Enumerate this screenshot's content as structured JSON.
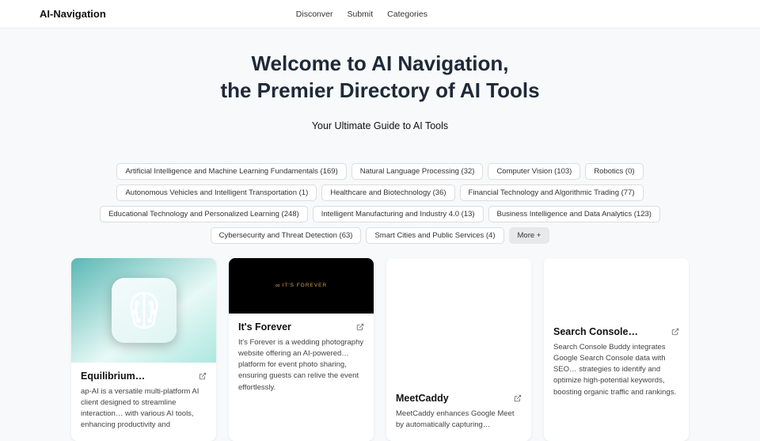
{
  "header": {
    "brand": "AI-Navigation",
    "links": [
      "Disconver",
      "Submit",
      "Categories"
    ]
  },
  "hero": {
    "title_line1": "Welcome to AI Navigation,",
    "title_line2": "the Premier Directory of AI Tools",
    "subtitle": "Your Ultimate Guide to AI Tools"
  },
  "categories": [
    "Artificial Intelligence and Machine Learning Fundamentals (169)",
    "Natural Language Processing (32)",
    "Computer Vision (103)",
    "Robotics (0)",
    "Autonomous Vehicles and Intelligent Transportation (1)",
    "Healthcare and Biotechnology (36)",
    "Financial Technology and Algorithmic Trading (77)",
    "Educational Technology and Personalized Learning (248)",
    "Intelligent Manufacturing and Industry 4.0 (13)",
    "Business Intelligence and Data Analytics (123)",
    "Cybersecurity and Threat Detection (63)",
    "Smart Cities and Public Services (4)"
  ],
  "more_label": "More +",
  "cards": [
    {
      "title": "Equilibrium…",
      "desc": "ap-AI is a versatile multi-platform AI client designed to streamline interaction… with various AI tools, enhancing productivity and"
    },
    {
      "title": "It's Forever",
      "desc": "It's Forever is a wedding photography website offering an AI-powered… platform for event photo sharing, ensuring guests can relive the event effortlessly."
    },
    {
      "title": "MeetCaddy",
      "desc": "MeetCaddy enhances Google Meet by automatically capturing…"
    },
    {
      "title": "Search Console…",
      "desc": "Search Console Buddy integrates Google Search Console data with SEO… strategies to identify and optimize high-potential keywords, boosting organic traffic and rankings."
    }
  ],
  "forever_logo_text": "IT'S FOREVER"
}
